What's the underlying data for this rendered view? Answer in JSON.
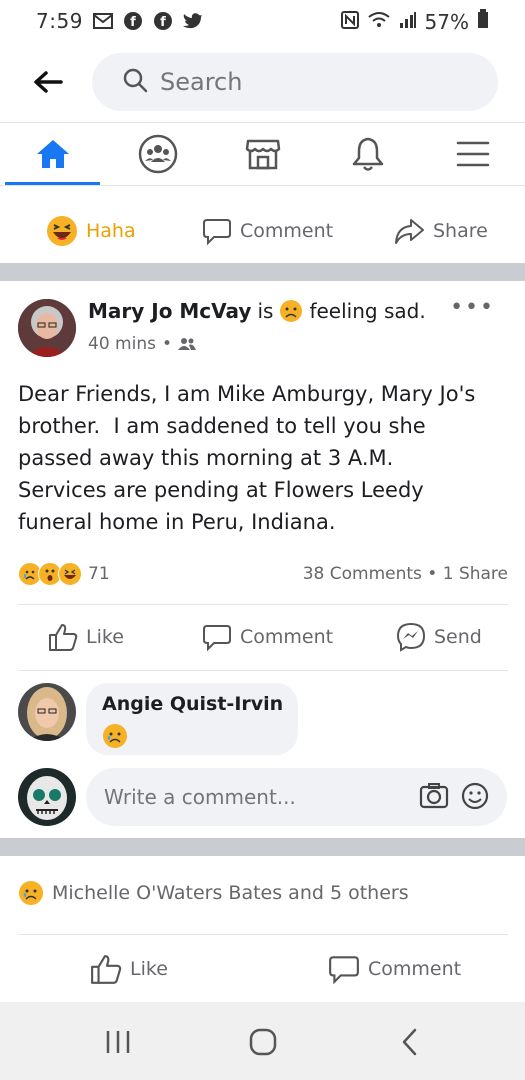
{
  "status": {
    "time": "7:59",
    "battery": "57%",
    "left_icons": [
      "mail-icon",
      "facebook-icon",
      "facebook-icon",
      "twitter-icon"
    ],
    "right_icons": [
      "nfc-icon",
      "wifi-icon",
      "signal-icon",
      "battery-icon"
    ]
  },
  "search": {
    "placeholder": "Search"
  },
  "tabs": [
    {
      "name": "home",
      "icon": "home-icon",
      "active": true
    },
    {
      "name": "groups",
      "icon": "groups-icon",
      "active": false
    },
    {
      "name": "marketplace",
      "icon": "marketplace-icon",
      "active": false
    },
    {
      "name": "notifications",
      "icon": "bell-icon",
      "active": false
    },
    {
      "name": "menu",
      "icon": "menu-icon",
      "active": false
    }
  ],
  "prev_post_actions": {
    "haha": "Haha",
    "comment": "Comment",
    "share": "Share"
  },
  "post": {
    "author": "Mary Jo McVay",
    "is_text": "is",
    "feeling": "feeling sad.",
    "time": "40 mins",
    "more": "•••",
    "body": "Dear Friends, I am Mike Amburgy, Mary Jo's\nbrother.  I am saddened to tell you she\npassed away this morning at 3 A.M.\nServices are pending at Flowers Leedy\nfuneral home in Peru, Indiana.",
    "reaction_count": "71",
    "comments_shares": "38 Comments • 1 Share",
    "actions": {
      "like": "Like",
      "comment": "Comment",
      "send": "Send"
    }
  },
  "comment": {
    "author": "Angie Quist-Irvin"
  },
  "write_comment": {
    "placeholder": "Write a comment..."
  },
  "next_post": {
    "reactions_text": "Michelle O'Waters Bates and 5 others",
    "actions": {
      "like": "Like",
      "comment": "Comment"
    }
  },
  "colors": {
    "accent": "#1877f2",
    "divider": "#c9ccd1",
    "haha": "#f7b125",
    "sad": "#f7b125"
  }
}
